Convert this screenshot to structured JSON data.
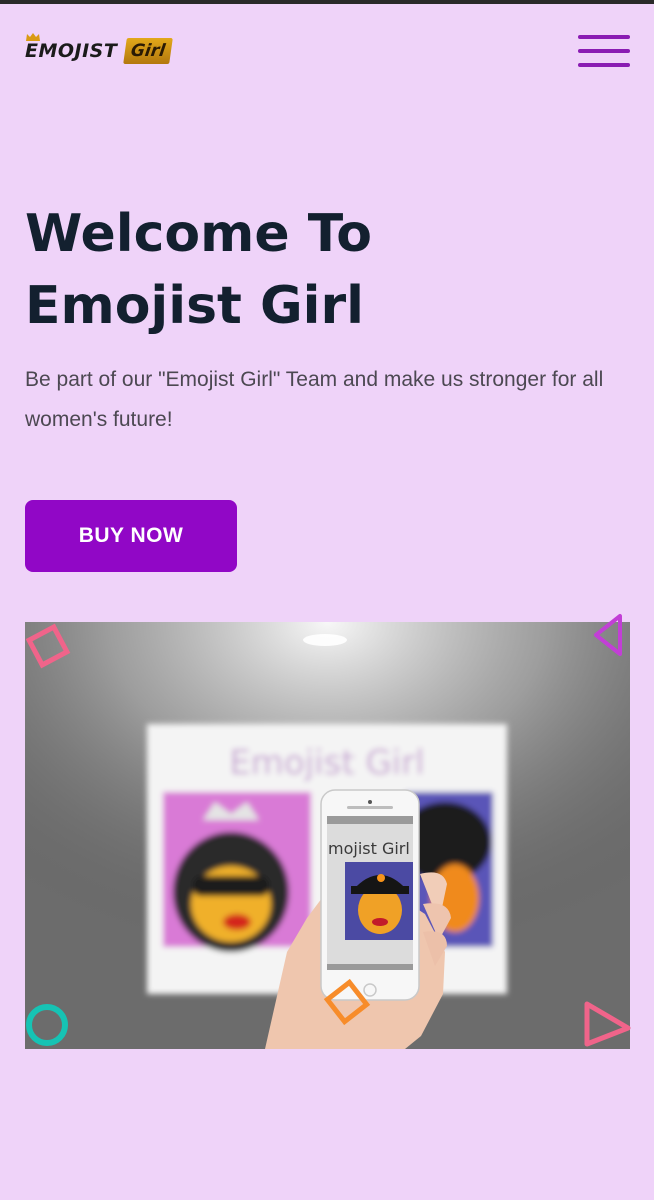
{
  "brand": {
    "logo_word": "EMOJIST",
    "logo_badge": "Girl",
    "logo_gold": "#d99a14"
  },
  "header": {
    "menu_icon": "hamburger-menu-icon"
  },
  "hero": {
    "title_line1": "Welcome To",
    "title_line2": "Emojist Girl",
    "subtitle": "Be part of our \"Emojist Girl\" Team and make us stronger for all women's future!",
    "buy_label": "BUY NOW"
  },
  "image": {
    "poster_title": "Emojist Girl",
    "phone_title": "mojist Girl"
  },
  "colors": {
    "background": "#efd3f9",
    "accent": "#9107c6",
    "heading": "#13202f",
    "decor_pink": "#f0648a",
    "decor_magenta": "#c23fd6",
    "decor_teal": "#16c3b4",
    "decor_orange": "#f78c2a"
  }
}
